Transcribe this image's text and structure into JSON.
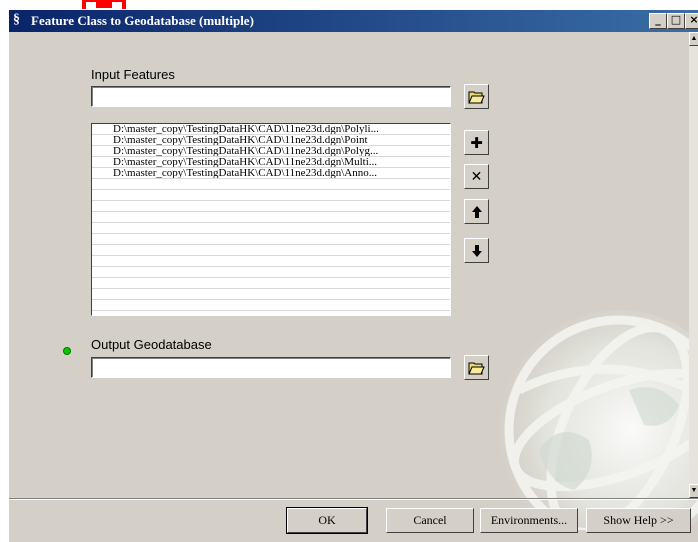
{
  "window": {
    "title": "Feature Class to Geodatabase (multiple)",
    "app_icon": "toolbox-icon",
    "minimize_label": "_",
    "maximize_label": "□",
    "close_label": "×"
  },
  "input_features": {
    "label": "Input Features",
    "value": "",
    "browse_icon": "open-folder-icon"
  },
  "feature_list": {
    "items": [
      "D:\\master_copy\\TestingDataHK\\CAD\\11ne23d.dgn\\Polyli...",
      "D:\\master_copy\\TestingDataHK\\CAD\\11ne23d.dgn\\Point",
      "D:\\master_copy\\TestingDataHK\\CAD\\11ne23d.dgn\\Polyg...",
      "D:\\master_copy\\TestingDataHK\\CAD\\11ne23d.dgn\\Multi...",
      "D:\\master_copy\\TestingDataHK\\CAD\\11ne23d.dgn\\Anno..."
    ],
    "actions": [
      {
        "name": "add-icon",
        "glyph": "✚"
      },
      {
        "name": "remove-icon",
        "glyph": "✕"
      },
      {
        "name": "move-up-icon",
        "glyph": "🡅"
      },
      {
        "name": "move-down-icon",
        "glyph": "🡇"
      }
    ]
  },
  "output_geodatabase": {
    "label": "Output Geodatabase",
    "value": "",
    "required_indicator_color": "#00cc00",
    "browse_icon": "open-folder-icon"
  },
  "buttons": {
    "ok": "OK",
    "cancel": "Cancel",
    "environments": "Environments...",
    "show_help": "Show Help >>"
  },
  "colors": {
    "title_bar": "#0a246a",
    "annotation_arrow": "#ff0000",
    "dialog_face": "#d4d0c8"
  }
}
